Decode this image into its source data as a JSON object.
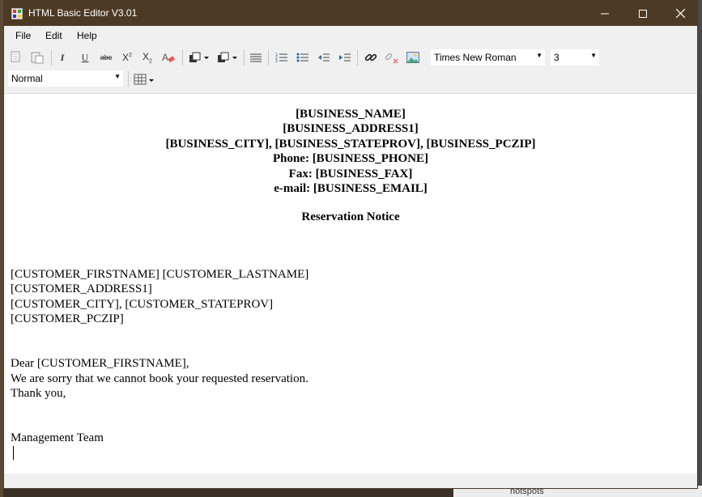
{
  "window": {
    "title": "HTML Basic Editor V3.01"
  },
  "menu": {
    "file": "File",
    "edit": "Edit",
    "help": "Help"
  },
  "toolbar": {
    "font_name": "Times New Roman",
    "font_size": "3",
    "style": "Normal"
  },
  "document": {
    "header_lines": [
      "[BUSINESS_NAME]",
      "[BUSINESS_ADDRESS1]",
      "[BUSINESS_CITY], [BUSINESS_STATEPROV], [BUSINESS_PCZIP]",
      "Phone: [BUSINESS_PHONE]",
      "Fax: [BUSINESS_FAX]",
      "e-mail: [BUSINESS_EMAIL]"
    ],
    "notice_title": "Reservation Notice",
    "address_lines": [
      "[CUSTOMER_FIRSTNAME] [CUSTOMER_LASTNAME]",
      "[CUSTOMER_ADDRESS1]",
      "[CUSTOMER_CITY], [CUSTOMER_STATEPROV]",
      "[CUSTOMER_PCZIP]"
    ],
    "body_lines": [
      "Dear [CUSTOMER_FIRSTNAME],",
      "We are sorry that we cannot book your requested reservation.",
      "Thank you,"
    ],
    "signature": "Management Team"
  },
  "desktop": {
    "folder_label": "hotspots"
  }
}
